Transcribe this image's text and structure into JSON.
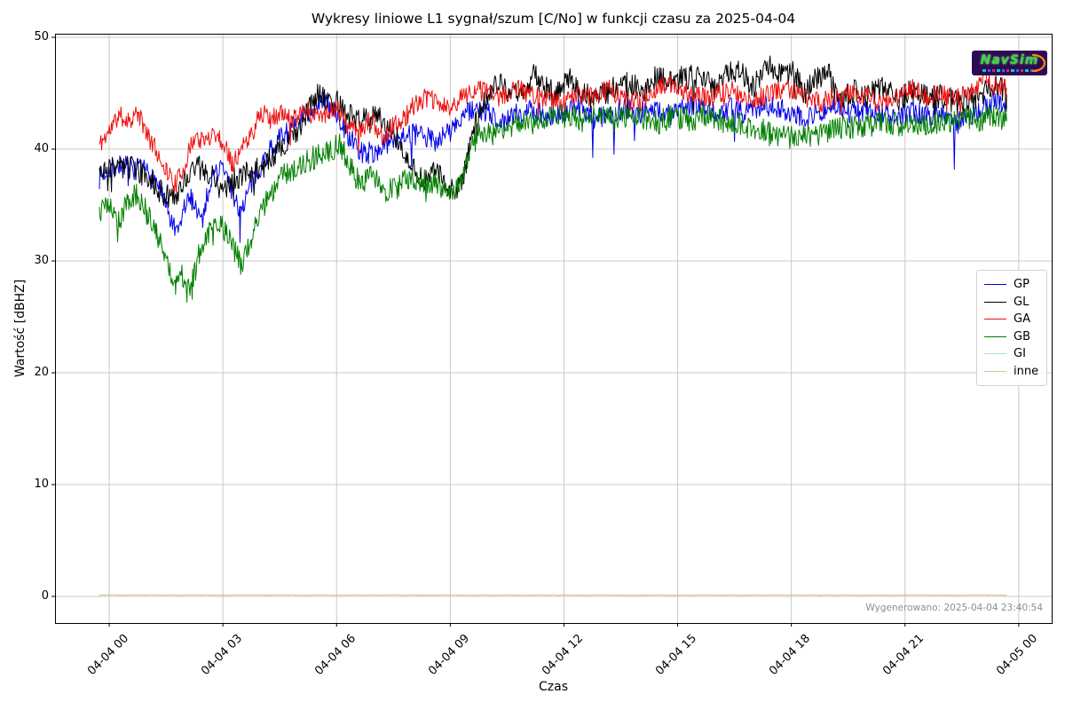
{
  "figure": {
    "title": "Wykresy liniowe L1 sygnał/szum [C/No] w funkcji czasu za 2025-04-04",
    "xlabel": "Czas",
    "ylabel": "Wartość [dBHZ]",
    "footer": "Wygenerowano: 2025-04-04 23:40:54",
    "logo_text": "NavSim"
  },
  "chart_data": {
    "type": "line",
    "title": "Wykresy liniowe L1 sygnał/szum [C/No] w funkcji czasu za 2025-04-04",
    "xlabel": "Czas",
    "ylabel": "Wartość [dBHZ]",
    "x_unit": "hours since 2025-04-04 00:00",
    "xlim": [
      -1.43,
      24.87
    ],
    "ylim": [
      -2.38,
      50.32
    ],
    "grid": true,
    "grid_color": "#c9c9c9",
    "legend_position": "upper right",
    "xticks": [
      {
        "t": 0,
        "label": "04-04 00"
      },
      {
        "t": 3,
        "label": "04-04 03"
      },
      {
        "t": 6,
        "label": "04-04 06"
      },
      {
        "t": 9,
        "label": "04-04 09"
      },
      {
        "t": 12,
        "label": "04-04 12"
      },
      {
        "t": 15,
        "label": "04-04 15"
      },
      {
        "t": 18,
        "label": "04-04 18"
      },
      {
        "t": 21,
        "label": "04-04 21"
      },
      {
        "t": 24,
        "label": "04-05 00"
      }
    ],
    "yticks": [
      0,
      10,
      20,
      30,
      40,
      50
    ],
    "series": [
      {
        "name": "GP",
        "color": "#0000e8",
        "noise": 1.0,
        "spike_prob": 0.008,
        "spike_depth": 4.5,
        "seed": 7,
        "points": [
          [
            -0.26,
            37.4
          ],
          [
            0,
            38.3
          ],
          [
            0.3,
            38.6
          ],
          [
            0.7,
            38.2
          ],
          [
            1.0,
            38.0
          ],
          [
            1.3,
            36.8
          ],
          [
            1.55,
            34.2
          ],
          [
            1.8,
            32.2
          ],
          [
            2.0,
            35.0
          ],
          [
            2.2,
            35.6
          ],
          [
            2.45,
            33.6
          ],
          [
            2.7,
            37.6
          ],
          [
            3.0,
            38.4
          ],
          [
            3.2,
            36.6
          ],
          [
            3.45,
            34.4
          ],
          [
            3.7,
            36.4
          ],
          [
            4.0,
            38.6
          ],
          [
            4.3,
            40.2
          ],
          [
            4.7,
            41.6
          ],
          [
            5.0,
            42.4
          ],
          [
            5.3,
            43.4
          ],
          [
            5.6,
            44.6
          ],
          [
            5.8,
            43.6
          ],
          [
            6.0,
            43.2
          ],
          [
            6.3,
            41.2
          ],
          [
            6.6,
            39.8
          ],
          [
            7.0,
            39.6
          ],
          [
            7.4,
            40.8
          ],
          [
            7.8,
            41.4
          ],
          [
            8.2,
            41.2
          ],
          [
            8.6,
            40.8
          ],
          [
            9.0,
            41.6
          ],
          [
            9.4,
            43.2
          ],
          [
            9.7,
            43.6
          ],
          [
            10.0,
            43.2
          ],
          [
            10.4,
            42.4
          ],
          [
            10.8,
            43.2
          ],
          [
            11.2,
            43.6
          ],
          [
            11.6,
            42.8
          ],
          [
            12.0,
            43.2
          ],
          [
            12.4,
            43.8
          ],
          [
            12.8,
            42.8
          ],
          [
            13.2,
            43.2
          ],
          [
            13.6,
            43.6
          ],
          [
            14.0,
            43.2
          ],
          [
            14.4,
            43.6
          ],
          [
            14.8,
            43.0
          ],
          [
            15.2,
            43.8
          ],
          [
            15.6,
            44.2
          ],
          [
            16.0,
            43.2
          ],
          [
            16.4,
            43.6
          ],
          [
            16.8,
            43.2
          ],
          [
            17.2,
            44.0
          ],
          [
            17.6,
            43.6
          ],
          [
            18.0,
            43.4
          ],
          [
            18.4,
            42.8
          ],
          [
            18.8,
            43.4
          ],
          [
            19.2,
            43.8
          ],
          [
            19.6,
            43.2
          ],
          [
            20.0,
            43.6
          ],
          [
            20.4,
            43.2
          ],
          [
            20.8,
            42.8
          ],
          [
            21.2,
            43.4
          ],
          [
            21.6,
            43.0
          ],
          [
            22.0,
            43.4
          ],
          [
            22.4,
            42.4
          ],
          [
            22.8,
            43.2
          ],
          [
            23.2,
            44.0
          ],
          [
            23.45,
            44.6
          ],
          [
            23.68,
            43.6
          ]
        ]
      },
      {
        "name": "GL",
        "color": "#000000",
        "noise": 1.1,
        "spike_prob": 0.012,
        "spike_depth": 2.5,
        "seed": 3,
        "points": [
          [
            -0.26,
            37.8
          ],
          [
            0,
            38.5
          ],
          [
            0.3,
            38.4
          ],
          [
            0.7,
            38.2
          ],
          [
            1.0,
            37.6
          ],
          [
            1.3,
            36.4
          ],
          [
            1.6,
            35.6
          ],
          [
            1.8,
            35.8
          ],
          [
            2.0,
            37.2
          ],
          [
            2.3,
            38.4
          ],
          [
            2.6,
            38.0
          ],
          [
            3.0,
            36.2
          ],
          [
            3.3,
            37.4
          ],
          [
            3.6,
            37.8
          ],
          [
            4.0,
            38.2
          ],
          [
            4.4,
            39.6
          ],
          [
            4.8,
            41.0
          ],
          [
            5.2,
            43.0
          ],
          [
            5.5,
            45.0
          ],
          [
            5.8,
            44.4
          ],
          [
            6.0,
            44.2
          ],
          [
            6.3,
            43.0
          ],
          [
            6.6,
            42.6
          ],
          [
            7.0,
            43.2
          ],
          [
            7.3,
            42.0
          ],
          [
            7.6,
            41.0
          ],
          [
            8.0,
            38.6
          ],
          [
            8.3,
            37.0
          ],
          [
            8.6,
            38.2
          ],
          [
            8.9,
            36.6
          ],
          [
            9.1,
            36.2
          ],
          [
            9.3,
            36.8
          ],
          [
            9.5,
            39.8
          ],
          [
            9.75,
            43.4
          ],
          [
            10.0,
            44.8
          ],
          [
            10.3,
            46.2
          ],
          [
            10.6,
            45.0
          ],
          [
            10.9,
            44.6
          ],
          [
            11.2,
            46.8
          ],
          [
            11.5,
            45.6
          ],
          [
            11.8,
            44.8
          ],
          [
            12.1,
            46.4
          ],
          [
            12.4,
            45.2
          ],
          [
            12.7,
            44.6
          ],
          [
            13.0,
            44.8
          ],
          [
            13.4,
            45.6
          ],
          [
            13.8,
            46.0
          ],
          [
            14.1,
            44.8
          ],
          [
            14.4,
            46.4
          ],
          [
            14.8,
            46.0
          ],
          [
            15.2,
            46.4
          ],
          [
            15.6,
            46.6
          ],
          [
            16.0,
            45.2
          ],
          [
            16.3,
            46.6
          ],
          [
            16.6,
            47.0
          ],
          [
            17.0,
            45.6
          ],
          [
            17.4,
            47.4
          ],
          [
            17.8,
            46.6
          ],
          [
            18.1,
            47.0
          ],
          [
            18.35,
            44.8
          ],
          [
            18.6,
            46.2
          ],
          [
            19.0,
            46.6
          ],
          [
            19.3,
            44.2
          ],
          [
            19.6,
            45.2
          ],
          [
            20.0,
            44.8
          ],
          [
            20.4,
            45.6
          ],
          [
            20.8,
            44.4
          ],
          [
            21.2,
            45.2
          ],
          [
            21.6,
            44.6
          ],
          [
            22.0,
            44.8
          ],
          [
            22.4,
            44.2
          ],
          [
            22.8,
            44.6
          ],
          [
            23.2,
            45.4
          ],
          [
            23.45,
            45.6
          ],
          [
            23.68,
            44.9
          ]
        ]
      },
      {
        "name": "GA",
        "color": "#ee1111",
        "noise": 0.9,
        "spike_prob": 0.01,
        "spike_depth": 2.2,
        "seed": 11,
        "points": [
          [
            -0.26,
            40.4
          ],
          [
            0,
            41.6
          ],
          [
            0.25,
            43.0
          ],
          [
            0.5,
            42.6
          ],
          [
            0.75,
            43.2
          ],
          [
            1.0,
            41.4
          ],
          [
            1.25,
            39.8
          ],
          [
            1.5,
            38.2
          ],
          [
            1.75,
            36.8
          ],
          [
            2.0,
            38.6
          ],
          [
            2.25,
            41.2
          ],
          [
            2.5,
            40.6
          ],
          [
            2.75,
            41.6
          ],
          [
            3.0,
            40.6
          ],
          [
            3.25,
            38.8
          ],
          [
            3.5,
            40.0
          ],
          [
            3.75,
            41.2
          ],
          [
            4.0,
            43.4
          ],
          [
            4.25,
            42.6
          ],
          [
            4.5,
            43.2
          ],
          [
            4.8,
            42.6
          ],
          [
            5.1,
            43.6
          ],
          [
            5.4,
            43.0
          ],
          [
            5.7,
            43.4
          ],
          [
            6.0,
            43.6
          ],
          [
            6.3,
            42.0
          ],
          [
            6.6,
            41.6
          ],
          [
            6.9,
            42.6
          ],
          [
            7.2,
            41.2
          ],
          [
            7.5,
            42.0
          ],
          [
            7.8,
            42.8
          ],
          [
            8.1,
            44.2
          ],
          [
            8.4,
            44.6
          ],
          [
            8.7,
            44.0
          ],
          [
            9.0,
            43.6
          ],
          [
            9.3,
            44.6
          ],
          [
            9.6,
            45.4
          ],
          [
            10.0,
            45.0
          ],
          [
            10.4,
            44.6
          ],
          [
            10.8,
            45.4
          ],
          [
            11.2,
            44.8
          ],
          [
            11.6,
            44.4
          ],
          [
            12.0,
            44.2
          ],
          [
            12.4,
            45.0
          ],
          [
            12.8,
            44.6
          ],
          [
            13.2,
            45.4
          ],
          [
            13.6,
            44.4
          ],
          [
            14.0,
            44.2
          ],
          [
            14.4,
            45.4
          ],
          [
            14.8,
            45.8
          ],
          [
            15.2,
            45.2
          ],
          [
            15.6,
            44.6
          ],
          [
            16.0,
            44.8
          ],
          [
            16.4,
            45.4
          ],
          [
            16.8,
            44.2
          ],
          [
            17.2,
            44.6
          ],
          [
            17.6,
            45.2
          ],
          [
            18.0,
            45.4
          ],
          [
            18.4,
            44.6
          ],
          [
            18.8,
            44.2
          ],
          [
            19.2,
            44.8
          ],
          [
            19.6,
            45.0
          ],
          [
            20.0,
            44.6
          ],
          [
            20.4,
            44.2
          ],
          [
            20.8,
            44.8
          ],
          [
            21.2,
            45.4
          ],
          [
            21.6,
            44.6
          ],
          [
            22.0,
            45.0
          ],
          [
            22.4,
            44.6
          ],
          [
            22.8,
            45.2
          ],
          [
            23.1,
            46.4
          ],
          [
            23.4,
            45.6
          ],
          [
            23.68,
            45.5
          ]
        ]
      },
      {
        "name": "GB",
        "color": "#007f00",
        "noise": 1.1,
        "spike_prob": 0.012,
        "spike_depth": 2.5,
        "seed": 5,
        "points": [
          [
            -0.26,
            34.4
          ],
          [
            0,
            35.0
          ],
          [
            0.25,
            33.6
          ],
          [
            0.5,
            35.4
          ],
          [
            0.75,
            36.0
          ],
          [
            1.0,
            34.2
          ],
          [
            1.25,
            32.6
          ],
          [
            1.5,
            30.6
          ],
          [
            1.75,
            27.6
          ],
          [
            1.9,
            29.4
          ],
          [
            2.05,
            27.4
          ],
          [
            2.2,
            28.2
          ],
          [
            2.4,
            31.0
          ],
          [
            2.7,
            33.0
          ],
          [
            3.0,
            33.2
          ],
          [
            3.25,
            31.2
          ],
          [
            3.5,
            29.6
          ],
          [
            3.75,
            32.2
          ],
          [
            4.0,
            34.6
          ],
          [
            4.3,
            36.2
          ],
          [
            4.6,
            37.6
          ],
          [
            5.0,
            38.6
          ],
          [
            5.4,
            39.2
          ],
          [
            5.8,
            40.0
          ],
          [
            6.1,
            40.4
          ],
          [
            6.35,
            38.4
          ],
          [
            6.6,
            37.0
          ],
          [
            7.0,
            37.6
          ],
          [
            7.3,
            36.2
          ],
          [
            7.6,
            36.6
          ],
          [
            8.0,
            37.6
          ],
          [
            8.4,
            37.0
          ],
          [
            8.8,
            36.4
          ],
          [
            9.1,
            36.2
          ],
          [
            9.35,
            37.8
          ],
          [
            9.6,
            40.6
          ],
          [
            9.85,
            41.6
          ],
          [
            10.1,
            41.2
          ],
          [
            10.5,
            42.0
          ],
          [
            10.9,
            42.6
          ],
          [
            11.3,
            42.2
          ],
          [
            11.7,
            42.8
          ],
          [
            12.1,
            43.0
          ],
          [
            12.5,
            42.6
          ],
          [
            12.9,
            43.0
          ],
          [
            13.3,
            42.6
          ],
          [
            13.7,
            43.0
          ],
          [
            14.1,
            42.8
          ],
          [
            14.5,
            42.4
          ],
          [
            14.9,
            43.0
          ],
          [
            15.3,
            42.6
          ],
          [
            15.7,
            43.0
          ],
          [
            16.1,
            42.6
          ],
          [
            16.5,
            42.4
          ],
          [
            16.9,
            42.0
          ],
          [
            17.3,
            41.6
          ],
          [
            17.7,
            41.2
          ],
          [
            18.0,
            41.0
          ],
          [
            18.3,
            41.6
          ],
          [
            18.6,
            41.2
          ],
          [
            19.0,
            41.6
          ],
          [
            19.4,
            41.8
          ],
          [
            19.8,
            42.0
          ],
          [
            20.2,
            42.2
          ],
          [
            20.6,
            42.4
          ],
          [
            21.0,
            42.0
          ],
          [
            21.4,
            42.4
          ],
          [
            21.8,
            42.2
          ],
          [
            22.2,
            42.4
          ],
          [
            22.6,
            42.8
          ],
          [
            23.0,
            42.6
          ],
          [
            23.35,
            43.0
          ],
          [
            23.68,
            42.5
          ]
        ]
      },
      {
        "name": "GI",
        "color": "#add8e6",
        "noise": 0,
        "seed": 13,
        "points": []
      },
      {
        "name": "inne",
        "color": "#ddc094",
        "noise": 0.04,
        "seed": 9,
        "points": [
          [
            -0.26,
            0.12
          ],
          [
            23.68,
            0.12
          ]
        ]
      }
    ]
  }
}
